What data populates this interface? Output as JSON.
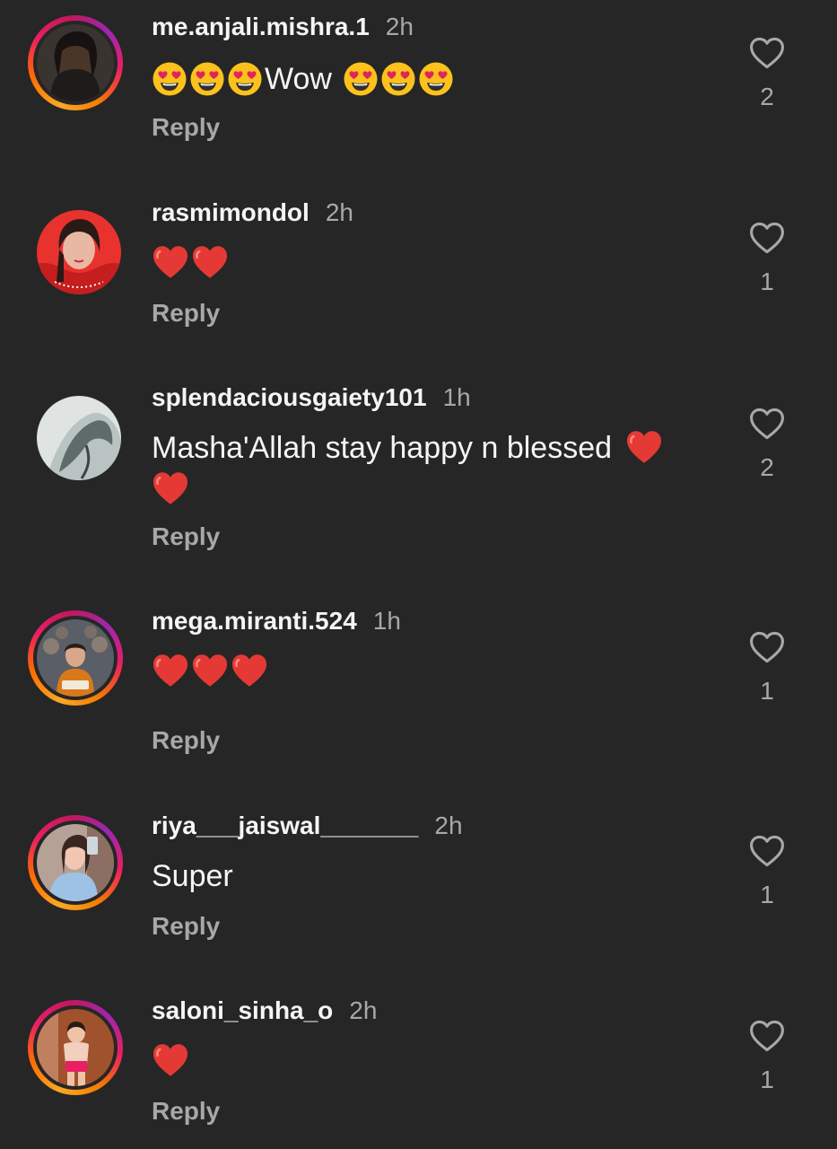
{
  "comments": [
    {
      "username": "me.anjali.mishra.1",
      "time": "2h",
      "text_parts": [
        "😍😍😍",
        "Wow",
        "😍😍😍"
      ],
      "reply_label": "Reply",
      "like_count": "2",
      "story_ring": true
    },
    {
      "username": "rasmimondol",
      "time": "2h",
      "text": "❤️❤️",
      "reply_label": "Reply",
      "like_count": "1",
      "story_ring": false
    },
    {
      "username": "splendaciousgaiety101",
      "time": "1h",
      "text": "Masha'Allah stay happy n blessed",
      "text_trailing": "❤️❤️",
      "reply_label": "Reply",
      "like_count": "2",
      "story_ring": false
    },
    {
      "username": "mega.miranti.524",
      "time": "1h",
      "text": "❤️❤️❤️",
      "reply_label": "Reply",
      "like_count": "1",
      "story_ring": true
    },
    {
      "username": "riya___jaiswal_______",
      "time": "2h",
      "text": "Super",
      "reply_label": "Reply",
      "like_count": "1",
      "story_ring": true
    },
    {
      "username": "saloni_sinha_o",
      "time": "2h",
      "text": "❤️",
      "reply_label": "Reply",
      "like_count": "1",
      "story_ring": true
    }
  ],
  "icons": {
    "like": "heart-outline-icon",
    "heart_emoji": "red-heart",
    "heart_eyes_emoji": "smiling-face-with-heart-eyes"
  },
  "colors": {
    "background": "#262626",
    "primary_text": "#f5f5f5",
    "secondary_text": "#a8a8a8",
    "heart_red": "#e53935",
    "emoji_yellow": "#fcc21b"
  }
}
